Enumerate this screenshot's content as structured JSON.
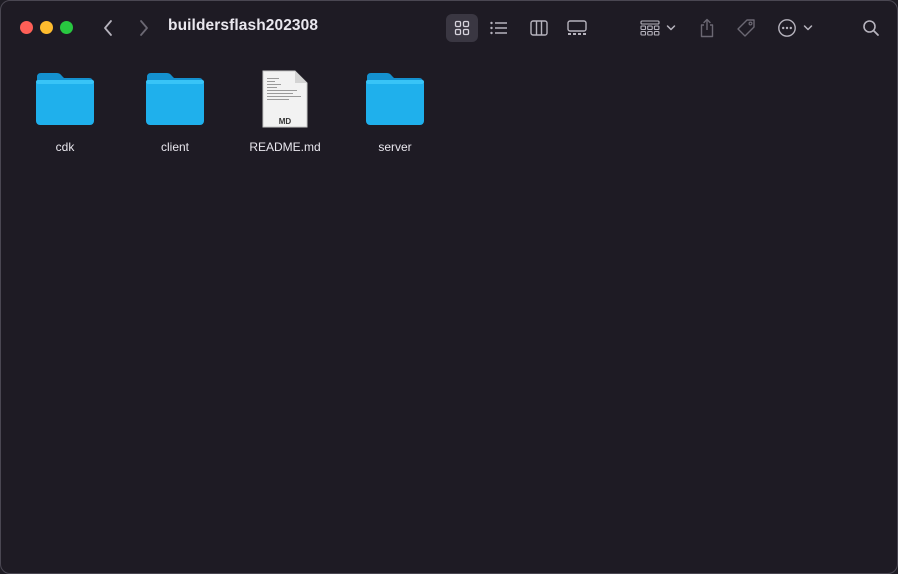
{
  "window": {
    "title": "buildersflash202308"
  },
  "toolbar": {
    "traffic_lights": [
      {
        "name": "close",
        "color": "#fe5f57"
      },
      {
        "name": "minimize",
        "color": "#febc2e"
      },
      {
        "name": "zoom",
        "color": "#28c840"
      }
    ],
    "navigation": [
      "chevron-left-icon",
      "chevron-right-icon"
    ],
    "view_modes": [
      "icon-view-icon",
      "list-view-icon",
      "column-view-icon",
      "gallery-view-icon"
    ],
    "active_view": "icon-view-icon",
    "actions": [
      "group-icon",
      "share-icon",
      "tag-icon",
      "more-icon",
      "search-icon"
    ]
  },
  "files": [
    {
      "name": "cdk",
      "kind": "folder"
    },
    {
      "name": "client",
      "kind": "folder"
    },
    {
      "name": "README.md",
      "kind": "document",
      "badge": "MD"
    },
    {
      "name": "server",
      "kind": "folder"
    }
  ],
  "colors": {
    "background": "#1e1b24",
    "folder": "#1fb0ec",
    "text": "#e9e7ee",
    "icon": "#b6b3bd",
    "icon_disabled": "#6b6873"
  }
}
